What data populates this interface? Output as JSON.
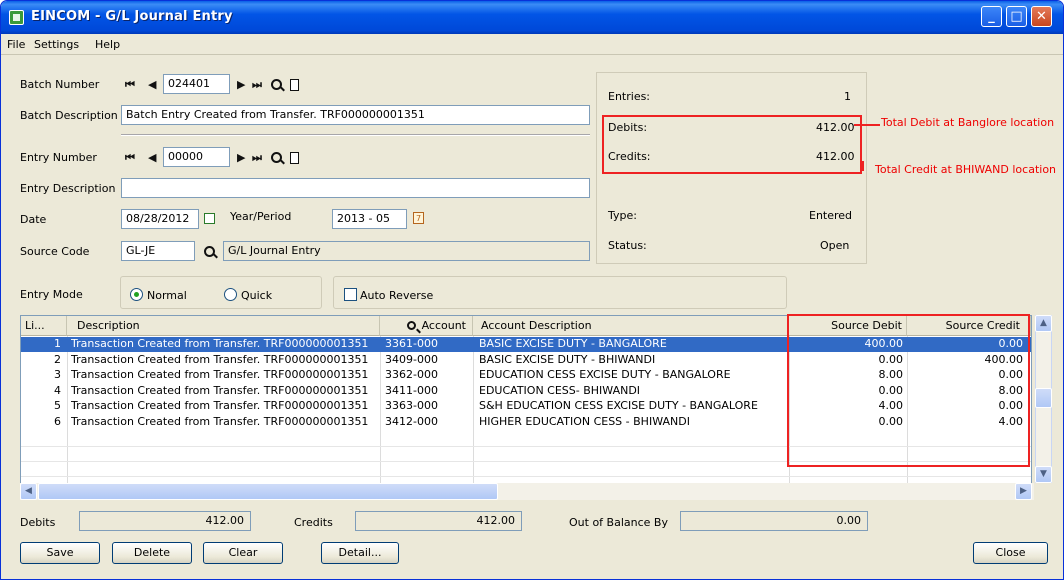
{
  "window": {
    "title": "EINCOM - G/L Journal Entry"
  },
  "menu": [
    "File",
    "Settings",
    "Help"
  ],
  "batch": {
    "number_label": "Batch Number",
    "number": "024401",
    "desc_label": "Batch Description",
    "desc": "Batch Entry Created from Transfer. TRF000000001351"
  },
  "entry": {
    "number_label": "Entry Number",
    "number": "00000",
    "desc_label": "Entry Description",
    "desc": "",
    "date_label": "Date",
    "date": "08/28/2012",
    "yp_label": "Year/Period",
    "yp": "2013 - 05",
    "source_label": "Source Code",
    "source": "GL-JE",
    "source_desc": "G/L Journal Entry"
  },
  "info": {
    "entries_label": "Entries:",
    "entries": "1",
    "debits_label": "Debits:",
    "debits": "412.00",
    "credits_label": "Credits:",
    "credits": "412.00",
    "type_label": "Type:",
    "type": "Entered",
    "status_label": "Status:",
    "status": "Open"
  },
  "annotations": {
    "debit": "Total Debit at Banglore location",
    "credit": "Total Credit at BHIWAND location"
  },
  "mode": {
    "label": "Entry Mode",
    "normal": "Normal",
    "quick": "Quick",
    "auto": "Auto Reverse"
  },
  "grid": {
    "headers": [
      "Li...",
      "Description",
      "Account",
      "Account Description",
      "Source Debit",
      "Source Credit"
    ],
    "rows": [
      [
        "1",
        "Transaction Created from Transfer. TRF000000001351",
        "3361-000",
        "BASIC EXCISE DUTY - BANGALORE",
        "400.00",
        "0.00"
      ],
      [
        "2",
        "Transaction Created from Transfer. TRF000000001351",
        "3409-000",
        "BASIC EXCISE DUTY - BHIWANDI",
        "0.00",
        "400.00"
      ],
      [
        "3",
        "Transaction Created from Transfer. TRF000000001351",
        "3362-000",
        "EDUCATION CESS EXCISE DUTY - BANGALORE",
        "8.00",
        "0.00"
      ],
      [
        "4",
        "Transaction Created from Transfer. TRF000000001351",
        "3411-000",
        "EDUCATION CESS- BHIWANDI",
        "0.00",
        "8.00"
      ],
      [
        "5",
        "Transaction Created from Transfer. TRF000000001351",
        "3363-000",
        "S&H EDUCATION CESS EXCISE DUTY - BANGALORE",
        "4.00",
        "0.00"
      ],
      [
        "6",
        "Transaction Created from Transfer. TRF000000001351",
        "3412-000",
        "HIGHER EDUCATION CESS - BHIWANDI",
        "0.00",
        "4.00"
      ]
    ]
  },
  "totals": {
    "debits_label": "Debits",
    "debits": "412.00",
    "credits_label": "Credits",
    "credits": "412.00",
    "oob_label": "Out of Balance By",
    "oob": "0.00"
  },
  "buttons": {
    "save": "Save",
    "delete": "Delete",
    "clear": "Clear",
    "detail": "Detail...",
    "close": "Close"
  },
  "colors": {
    "selection": "#316ac5",
    "annotation": "#ff0000"
  }
}
